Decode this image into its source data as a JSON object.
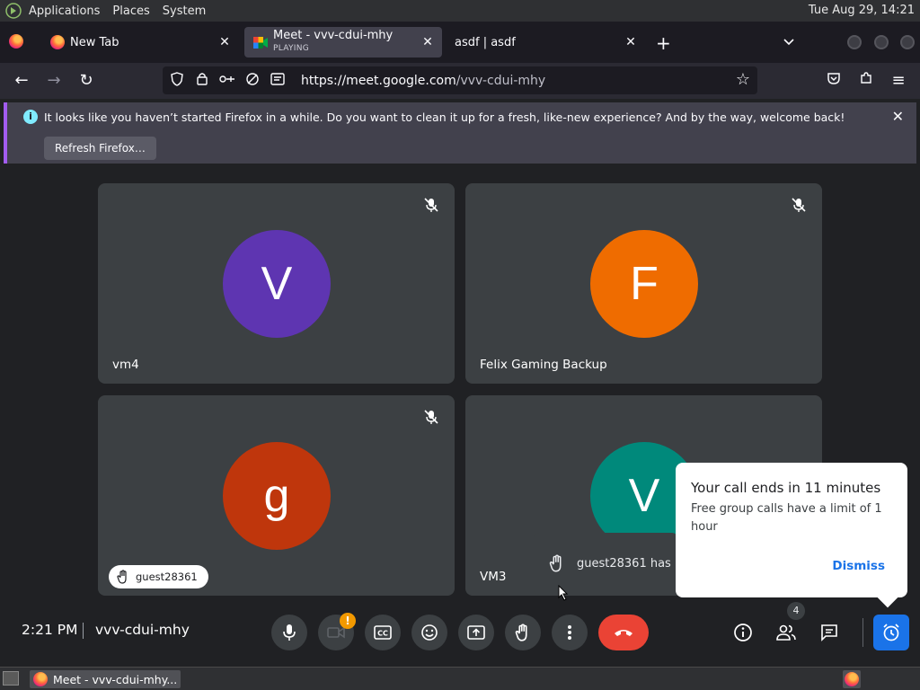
{
  "panel": {
    "menus": [
      "Applications",
      "Places",
      "System"
    ],
    "datetime": "Tue Aug 29, 14:21"
  },
  "tabs": [
    {
      "title": "New Tab"
    },
    {
      "title": "Meet - vvv-cdui-mhy",
      "subtitle": "PLAYING"
    },
    {
      "title": "asdf | asdf"
    }
  ],
  "urlbar": {
    "url_domain": "https://meet.google.com",
    "url_path": "/vvv-cdui-mhy"
  },
  "notification": {
    "message": "It looks like you haven’t started Firefox in a while. Do you want to clean it up for a fresh, like-new experience? And by the way, welcome back!",
    "button": "Refresh Firefox…"
  },
  "tiles": [
    {
      "name": "vm4",
      "initial": "V",
      "color": "#5e35b1"
    },
    {
      "name": "Felix Gaming Backup",
      "initial": "F",
      "color": "#ef6c00"
    },
    {
      "name": "guest28361",
      "initial": "g",
      "color": "#bf360c"
    },
    {
      "name": "VM3",
      "initial": "V",
      "color": "#00897b"
    }
  ],
  "hand_toast": "guest28361 has r",
  "time_popup": {
    "title": "Your call ends in 11 minutes",
    "body": "Free group calls have a limit of 1 hour",
    "dismiss": "Dismiss"
  },
  "bottom": {
    "time": "2:21 PM",
    "meeting_code": "vvv-cdui-mhy",
    "people_count": "4",
    "camera_alert": "!"
  },
  "taskbar": {
    "window_title": "Meet - vvv-cdui-mhy..."
  }
}
